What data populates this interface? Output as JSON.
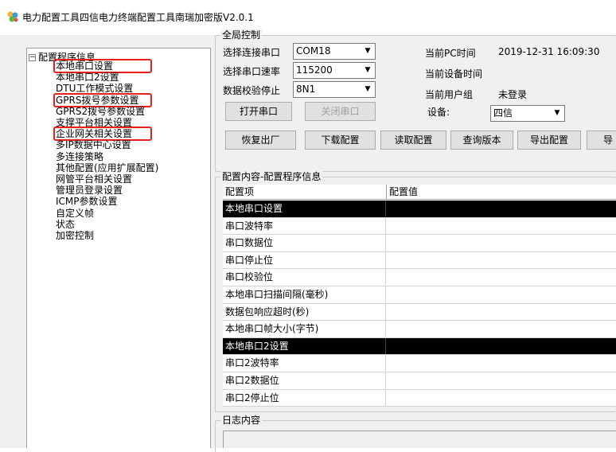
{
  "window": {
    "title": "电力配置工具四信电力终端配置工具南瑞加密版V2.0.1"
  },
  "tree": {
    "root_label": "配置程序信息",
    "toggle": "−",
    "items": [
      {
        "label": "本地串口设置",
        "highlighted": true
      },
      {
        "label": "本地串口2设置",
        "highlighted": false
      },
      {
        "label": "DTU工作模式设置",
        "highlighted": false
      },
      {
        "label": "GPRS拨号参数设置",
        "highlighted": true
      },
      {
        "label": "GPRS2拨号参数设置",
        "highlighted": false
      },
      {
        "label": "支撑平台相关设置",
        "highlighted": false
      },
      {
        "label": "企业网关相关设置",
        "highlighted": true
      },
      {
        "label": "多IP数据中心设置",
        "highlighted": false
      },
      {
        "label": "多连接策略",
        "highlighted": false
      },
      {
        "label": "其他配置(应用扩展配置)",
        "highlighted": false
      },
      {
        "label": "网管平台相关设置",
        "highlighted": false
      },
      {
        "label": "管理员登录设置",
        "highlighted": false
      },
      {
        "label": "ICMP参数设置",
        "highlighted": false
      },
      {
        "label": "自定义帧",
        "highlighted": false
      },
      {
        "label": "状态",
        "highlighted": false
      },
      {
        "label": "加密控制",
        "highlighted": false
      }
    ],
    "highlight_color": "#e8201a"
  },
  "global_control": {
    "group_label": "全局控制",
    "port_label": "选择连接串口",
    "port_value": "COM18",
    "baud_label": "选择串口速率",
    "baud_value": "115200",
    "parity_label": "数据校验停止",
    "parity_value": "8N1",
    "open_button": "打开串口",
    "close_button": "关闭串口",
    "pc_time_label": "当前PC时间",
    "pc_time_value": "2019-12-31 16:09:30",
    "device_time_label": "当前设备时间",
    "user_group_label": "当前用户组",
    "user_group_value": "未登录",
    "device_label": "设备:",
    "device_value": "四信",
    "restore_button": "恢复出厂",
    "download_button": "下载配置",
    "read_button": "读取配置",
    "query_version_button": "查询版本",
    "export_button": "导出配置",
    "cut_button": "导"
  },
  "config_content": {
    "group_label": "配置内容-配置程序信息",
    "col_item": "配置项",
    "col_value": "配置值",
    "rows": [
      {
        "item": "本地串口设置",
        "value": "",
        "section": true
      },
      {
        "item": "串口波特率",
        "value": "",
        "section": false
      },
      {
        "item": "串口数据位",
        "value": "",
        "section": false
      },
      {
        "item": "串口停止位",
        "value": "",
        "section": false
      },
      {
        "item": "串口校验位",
        "value": "",
        "section": false
      },
      {
        "item": "本地串口扫描间隔(毫秒)",
        "value": "",
        "section": false
      },
      {
        "item": "数据包响应超时(秒)",
        "value": "",
        "section": false
      },
      {
        "item": "本地串口帧大小(字节)",
        "value": "",
        "section": false
      },
      {
        "item": "本地串口2设置",
        "value": "",
        "section": true
      },
      {
        "item": "串口2波特率",
        "value": "",
        "section": false
      },
      {
        "item": "串口2数据位",
        "value": "",
        "section": false
      },
      {
        "item": "串口2停止位",
        "value": "",
        "section": false
      }
    ]
  },
  "log": {
    "group_label": "日志内容"
  }
}
